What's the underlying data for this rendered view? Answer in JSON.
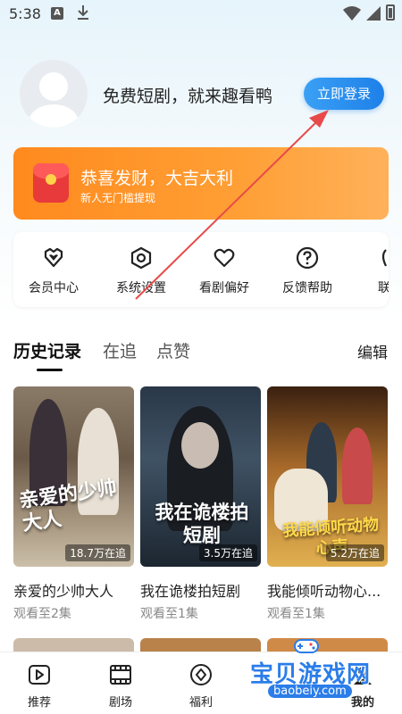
{
  "status_bar": {
    "time": "5:38",
    "notif_letter": "A",
    "icons": [
      "download-icon",
      "wifi-icon",
      "signal-icon",
      "battery-icon"
    ]
  },
  "profile": {
    "prompt": "免费短剧，就来趣看鸭",
    "login_label": "立即登录"
  },
  "banner": {
    "title": "恭喜发财，大吉大利",
    "subtitle": "新人无门槛提现",
    "icon": "red-envelope-icon"
  },
  "menu": {
    "items": [
      {
        "label": "会员中心",
        "icon": "vip-heart-icon"
      },
      {
        "label": "系统设置",
        "icon": "settings-hexagon-icon"
      },
      {
        "label": "看剧偏好",
        "icon": "heart-icon"
      },
      {
        "label": "反馈帮助",
        "icon": "help-icon"
      },
      {
        "label": "联系",
        "icon": "contact-icon"
      }
    ]
  },
  "tabs": {
    "history": "历史记录",
    "following": "在追",
    "liked": "点赞",
    "edit": "编辑"
  },
  "cards": [
    {
      "poster_art": "亲爱的少帅大人",
      "views": "18.7万在追",
      "title": "亲爱的少帅大人",
      "progress": "观看至2集"
    },
    {
      "poster_art": "我在诡楼拍短剧",
      "views": "3.5万在追",
      "title": "我在诡楼拍短剧",
      "progress": "观看至1集"
    },
    {
      "poster_art": "我能倾听动物心声",
      "views": "5.2万在追",
      "title": "我能倾听动物心...",
      "progress": "观看至1集"
    }
  ],
  "bottom_nav": {
    "items": [
      {
        "label": "推荐",
        "icon": "play-icon"
      },
      {
        "label": "剧场",
        "icon": "film-icon"
      },
      {
        "label": "福利",
        "icon": "gift-diamond-icon"
      },
      {
        "label": "我的",
        "icon": "profile-icon"
      }
    ]
  },
  "watermark": {
    "text": "宝贝游戏网",
    "url": "baobeiy.com"
  },
  "colors": {
    "accent_blue": "#1e80e8",
    "banner_orange": "#ff8a1e",
    "annotation_red": "#e84a4a"
  }
}
